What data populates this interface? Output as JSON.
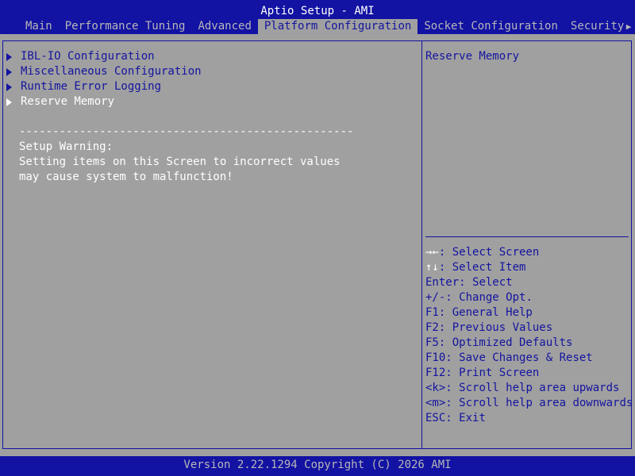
{
  "app": {
    "title": "Aptio Setup - AMI"
  },
  "tabs": [
    {
      "label": "Main"
    },
    {
      "label": "Performance Tuning"
    },
    {
      "label": "Advanced"
    },
    {
      "label": "Platform Configuration"
    },
    {
      "label": "Socket Configuration"
    },
    {
      "label": "Security"
    }
  ],
  "active_tab": "Platform Configuration",
  "tab_more_icon": "right-arrow-icon",
  "menu": {
    "items": [
      {
        "label": "IBL-IO Configuration"
      },
      {
        "label": "Miscellaneous Configuration"
      },
      {
        "label": "Runtime Error Logging"
      },
      {
        "label": "Reserve Memory"
      }
    ],
    "selected": "Reserve Memory"
  },
  "warning": {
    "separator": "--------------------------------------------------",
    "heading": "Setup Warning:",
    "line1": "Setting items on this Screen to incorrect values",
    "line2": "may cause system to malfunction!"
  },
  "help": {
    "description": "Reserve Memory",
    "keys": [
      {
        "key": "→←",
        "desc": ": Select Screen"
      },
      {
        "key": "↑↓",
        "desc": ": Select Item"
      },
      {
        "key": "Enter",
        "desc": ": Select"
      },
      {
        "key": "+/-",
        "desc": ": Change Opt."
      },
      {
        "key": "F1",
        "desc": ": General Help"
      },
      {
        "key": "F2",
        "desc": ": Previous Values"
      },
      {
        "key": "F5",
        "desc": ": Optimized Defaults"
      },
      {
        "key": "F10",
        "desc": ": Save Changes & Reset"
      },
      {
        "key": "F12",
        "desc": ": Print Screen"
      },
      {
        "key": "<k>",
        "desc": ": Scroll help area upwards"
      },
      {
        "key": "<m>",
        "desc": ": Scroll help area downwards"
      },
      {
        "key": "ESC",
        "desc": ": Exit"
      }
    ]
  },
  "footer": {
    "version": "Version 2.22.1294 Copyright (C) 2026 AMI"
  },
  "colors": {
    "header_bg": "#1212a3",
    "body_bg": "#a0a0a0",
    "accent": "#1414a0",
    "highlight_text": "#ffffff",
    "inactive_text": "#b7b7b7"
  }
}
